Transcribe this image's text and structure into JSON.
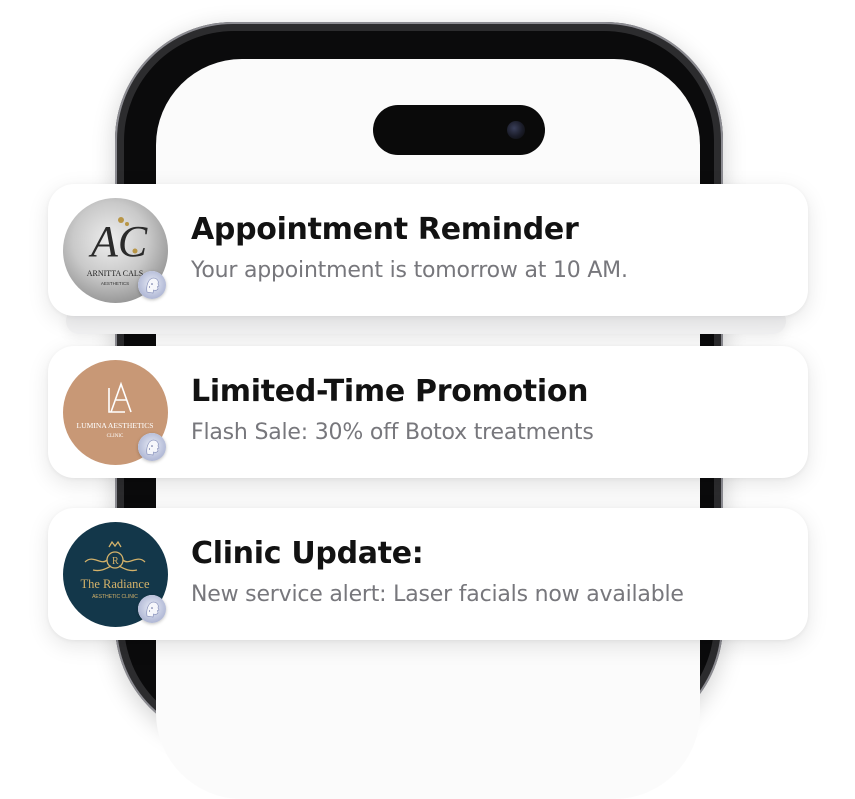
{
  "notifications": [
    {
      "title": "Appointment Reminder",
      "body": "Your appointment is tomorrow at 10 AM.",
      "avatar": {
        "logo_text": "AC",
        "name": "ARNITTA CALS",
        "subtitle": "AESTHETICS",
        "colors": [
          "#d7d7d7",
          "#8f8f8f",
          "#2a2a2a",
          "#b89545"
        ]
      }
    },
    {
      "title": "Limited-Time Promotion",
      "body": "Flash Sale: 30% off Botox treatments",
      "avatar": {
        "logo_text": "LA",
        "name": "LUMINA AESTHETICS",
        "subtitle": "CLINIC",
        "colors": [
          "#c89876",
          "#ffffff"
        ]
      }
    },
    {
      "title": "Clinic Update:",
      "body": "New service alert: Laser facials now available",
      "avatar": {
        "logo_text": "R",
        "name": "The Radiance",
        "subtitle": "AESTHETIC CLINIC",
        "colors": [
          "#13374a",
          "#d4b26a"
        ]
      }
    }
  ],
  "app_badge_icon": "face-profile-icon"
}
